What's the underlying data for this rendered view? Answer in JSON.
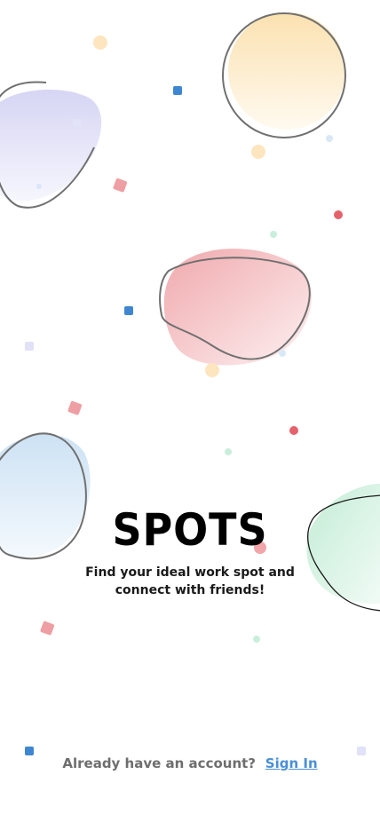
{
  "app": {
    "title": "SPOTS",
    "tagline": "Find your ideal work spot and connect with friends!"
  },
  "footer": {
    "prompt": "Already have an account?",
    "signin_label": "Sign In"
  },
  "colors": {
    "accent_link": "#4a8fd8",
    "blob_yellow": "#fbe3b6",
    "blob_purple": "#d9d8f5",
    "blob_red": "#f2b0b3",
    "blob_blue": "#cfe4f5",
    "blob_green": "#c8efdb"
  }
}
